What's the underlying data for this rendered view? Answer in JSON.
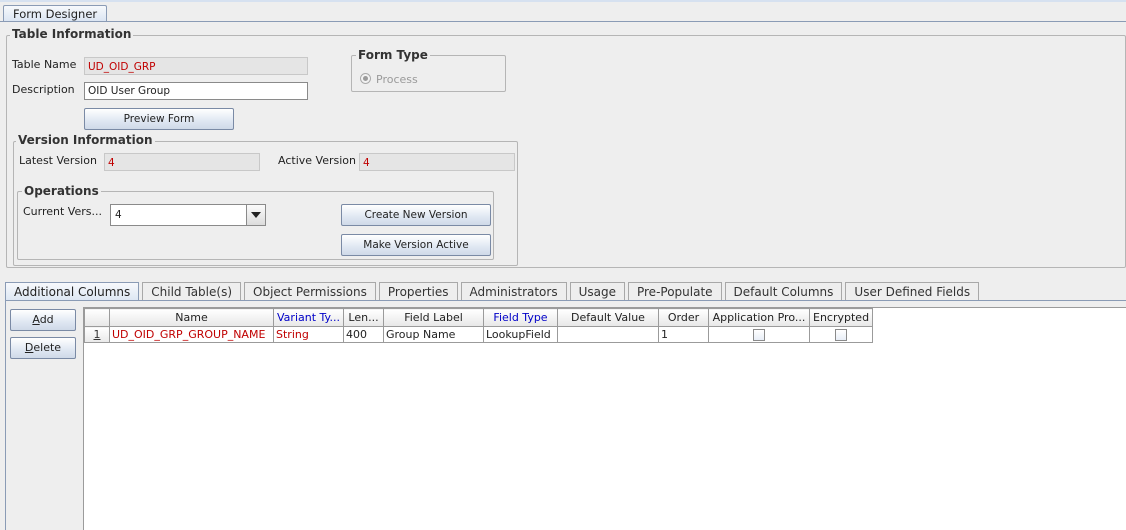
{
  "window_tab": "Form Designer",
  "table_info": {
    "legend": "Table Information",
    "table_name_label": "Table Name",
    "table_name_value": "UD_OID_GRP",
    "description_label": "Description",
    "description_value": "OID User Group",
    "preview_button": "Preview Form"
  },
  "form_type": {
    "legend": "Form Type",
    "option": "Process"
  },
  "version_info": {
    "legend": "Version Information",
    "latest_label": "Latest Version",
    "latest_value": "4",
    "active_label": "Active Version",
    "active_value": "4"
  },
  "operations": {
    "legend": "Operations",
    "current_label": "Current Vers...",
    "current_value": "4",
    "create_button": "Create New Version",
    "make_active_button": "Make Version Active"
  },
  "tabs": [
    {
      "label": "Additional Columns",
      "active": true
    },
    {
      "label": "Child Table(s)",
      "active": false
    },
    {
      "label": "Object Permissions",
      "active": false
    },
    {
      "label": "Properties",
      "active": false
    },
    {
      "label": "Administrators",
      "active": false
    },
    {
      "label": "Usage",
      "active": false
    },
    {
      "label": "Pre-Populate",
      "active": false
    },
    {
      "label": "Default Columns",
      "active": false
    },
    {
      "label": "User Defined Fields",
      "active": false
    }
  ],
  "side_buttons": {
    "add": "Add",
    "delete": "Delete"
  },
  "grid": {
    "columns": [
      "",
      "Name",
      "Variant Ty...",
      "Len...",
      "Field Label",
      "Field Type",
      "Default Value",
      "Order",
      "Application Pro...",
      "Encrypted"
    ],
    "rows": [
      {
        "num": "1",
        "name": "UD_OID_GRP_GROUP_NAME",
        "variant_type": "String",
        "length": "400",
        "field_label": "Group Name",
        "field_type": "LookupField",
        "default_value": "",
        "order": "1",
        "application_profile": false,
        "encrypted": false
      }
    ]
  },
  "colors": {
    "required_text": "#c00000",
    "header_blue": "#0000c8",
    "tab_border": "#8a9bb5"
  }
}
